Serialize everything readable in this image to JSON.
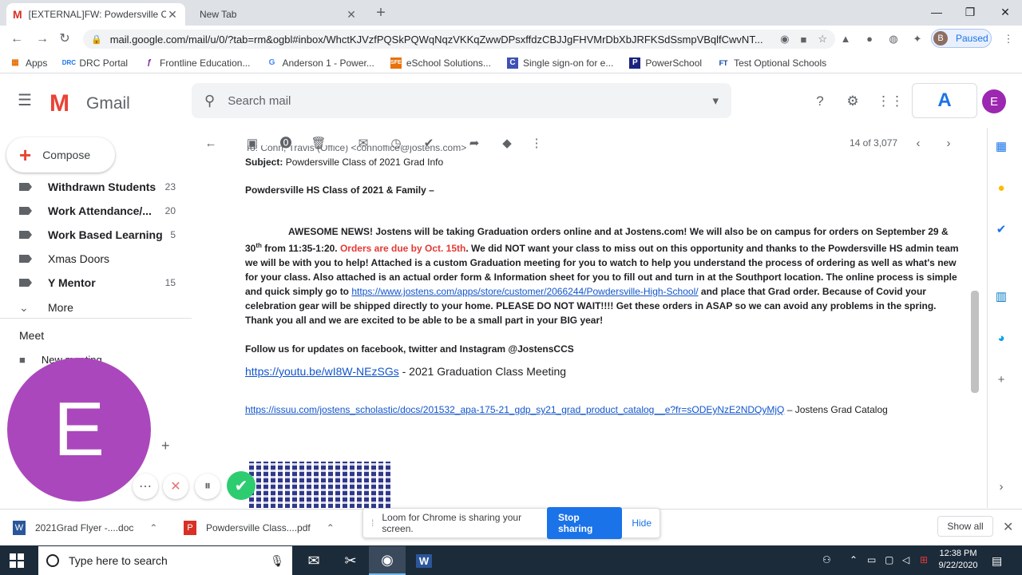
{
  "browser": {
    "tabs": [
      {
        "title": "[EXTERNAL]FW: Powdersville Clas",
        "active": true
      },
      {
        "title": "New Tab",
        "active": false
      }
    ],
    "url": "mail.google.com/mail/u/0/?tab=rm&ogbl#inbox/WhctKJVzfPQSkPQWqNqzVKKqZwwDPsxffdzCBJJgFHVMrDbXbJRFKSdSsmpVBqlfCwvNT...",
    "profile_label": "Paused",
    "profile_initial": "B",
    "bookmarks": [
      "Apps",
      "DRC Portal",
      "Frontline Education...",
      "Anderson 1 - Power...",
      "eSchool Solutions...",
      "Single sign-on for e...",
      "PowerSchool",
      "Test Optional Schools"
    ]
  },
  "gmail": {
    "logo_text": "Gmail",
    "search_placeholder": "Search mail",
    "account_initial": "E",
    "compose_label": "Compose",
    "labels": [
      {
        "name": "Withdrawn Students",
        "count": "23"
      },
      {
        "name": "Work Attendance/...",
        "count": "20"
      },
      {
        "name": "Work Based Learning",
        "count": "5"
      },
      {
        "name": "Xmas Doors",
        "count": ""
      },
      {
        "name": "Y Mentor",
        "count": "15"
      }
    ],
    "more_label": "More",
    "meet_heading": "Meet",
    "meet_item": "New meeting",
    "pager": "14 of 3,077"
  },
  "email": {
    "to_line": "To: Conn, Travis (Office) <connoffice@jostens.com>",
    "subject_label": "Subject:",
    "subject": "Powdersville Class of 2021 Grad Info",
    "greeting": "Powdersville HS Class of 2021 & Family –",
    "p1_a": "AWESOME NEWS! Jostens will be taking Graduation orders online and at Jostens.com! We will also be on campus for orders on September 29 & 30",
    "p1_sup": "th",
    "p1_b": " from 11:35-1:20. ",
    "p1_red": "Orders are due by Oct. 15th",
    "p1_c": ". We did NOT want your class to miss out on this opportunity and thanks to the Powdersville HS admin team we will be with you to help! Attached is a custom Graduation meeting for you to watch to help you understand the process of ordering as well as what's new for your class. Also attached is an actual order form & Information sheet for you to fill out and turn in at the Southport location. The online process is simple and quick simply go to ",
    "p1_link": "https://www.jostens.com/apps/store/customer/2066244/Powdersville-High-School/",
    "p1_d": " and place that Grad order. Because of Covid your celebration gear will be shipped directly to your home. PLEASE DO NOT WAIT!!!! Get these orders in ASAP so we can avoid any problems in the spring. Thank you all and we are excited to be able to be a small part in your BIG year!",
    "follow": "Follow us for updates on facebook, twitter and Instagram @JostensCCS",
    "yt_link": "https://youtu.be/wI8W-NEzSGs",
    "yt_text": " - 2021 Graduation Class Meeting",
    "issuu_link": "https://issuu.com/jostens_scholastic/docs/201532_apa-175-21_gdp_sy21_grad_product_catalog__e?fr=sODEyNzE2NDQyMjQ",
    "issuu_text": " – Jostens Grad Catalog"
  },
  "loom": {
    "bubble_initial": "E",
    "share_text": "Loom for Chrome is sharing your screen.",
    "stop_label": "Stop sharing",
    "hide_label": "Hide"
  },
  "downloads": [
    {
      "name": "2021Grad Flyer -....doc"
    },
    {
      "name": "Powdersville Class....pdf"
    }
  ],
  "downloads_show_all": "Show all",
  "taskbar": {
    "search_placeholder": "Type here to search",
    "time": "12:38 PM",
    "date": "9/22/2020"
  }
}
